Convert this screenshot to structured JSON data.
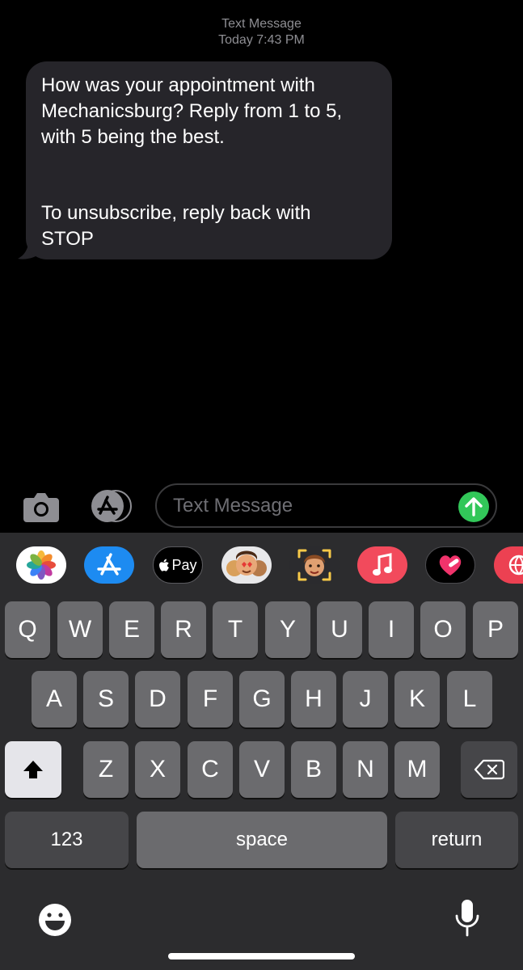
{
  "header": {
    "line1": "Text Message",
    "line2": "Today 7:43 PM"
  },
  "message": {
    "paragraph1": "How was your appointment with\nMechanicsburg? Reply from 1 to 5,\nwith 5 being the best.",
    "paragraph2": "To unsubscribe, reply back with\nSTOP"
  },
  "compose": {
    "placeholder": "Text Message",
    "send_icon": "arrow-up-icon",
    "camera_icon": "camera-icon",
    "apps_icon": "app-store-icon"
  },
  "app_drawer": [
    "photos",
    "app-store",
    "apple-pay",
    "memoji-stickers",
    "memoji",
    "music",
    "digital-touch",
    "web"
  ],
  "apple_pay_label": "Pay",
  "keyboard": {
    "row1": [
      "Q",
      "W",
      "E",
      "R",
      "T",
      "Y",
      "U",
      "I",
      "O",
      "P"
    ],
    "row2": [
      "A",
      "S",
      "D",
      "F",
      "G",
      "H",
      "J",
      "K",
      "L"
    ],
    "row3": [
      "Z",
      "X",
      "C",
      "V",
      "B",
      "N",
      "M"
    ],
    "numbers_label": "123",
    "space_label": "space",
    "return_label": "return",
    "shift_icon": "shift-icon",
    "delete_icon": "delete-icon",
    "emoji_icon": "emoji-icon",
    "mic_icon": "microphone-icon"
  },
  "colors": {
    "bubble": "#26252a",
    "send": "#32c759",
    "keyboard_bg": "#2c2c2e",
    "key": "#6b6b6e",
    "key_dark": "#464649"
  }
}
